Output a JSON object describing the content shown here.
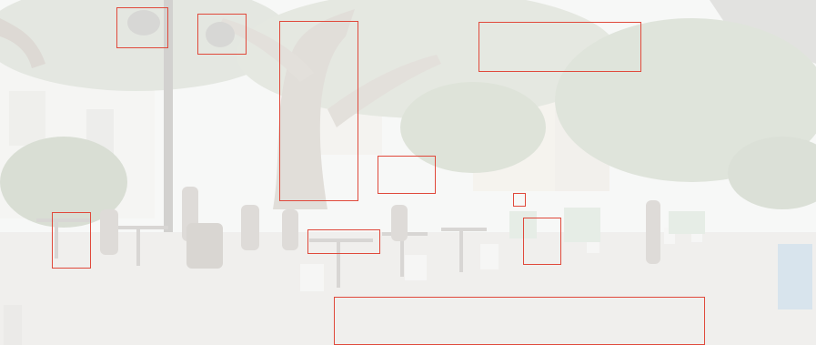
{
  "image": {
    "description_colors": {
      "sky": "#f2f3f1",
      "foliage": "#a9b5a0",
      "trunk": "#b9b2a8",
      "pavement": "#dcdad6",
      "building": "#ecebe6",
      "box_outline": "#e0493b"
    }
  },
  "highlight_boxes": [
    {
      "label": ""
    },
    {
      "label": ""
    },
    {
      "label": ""
    },
    {
      "label": ""
    },
    {
      "label": ""
    },
    {
      "label": ""
    },
    {
      "label": ""
    },
    {
      "label": ""
    },
    {
      "label": ""
    },
    {
      "label": ""
    },
    {
      "label": ""
    }
  ]
}
